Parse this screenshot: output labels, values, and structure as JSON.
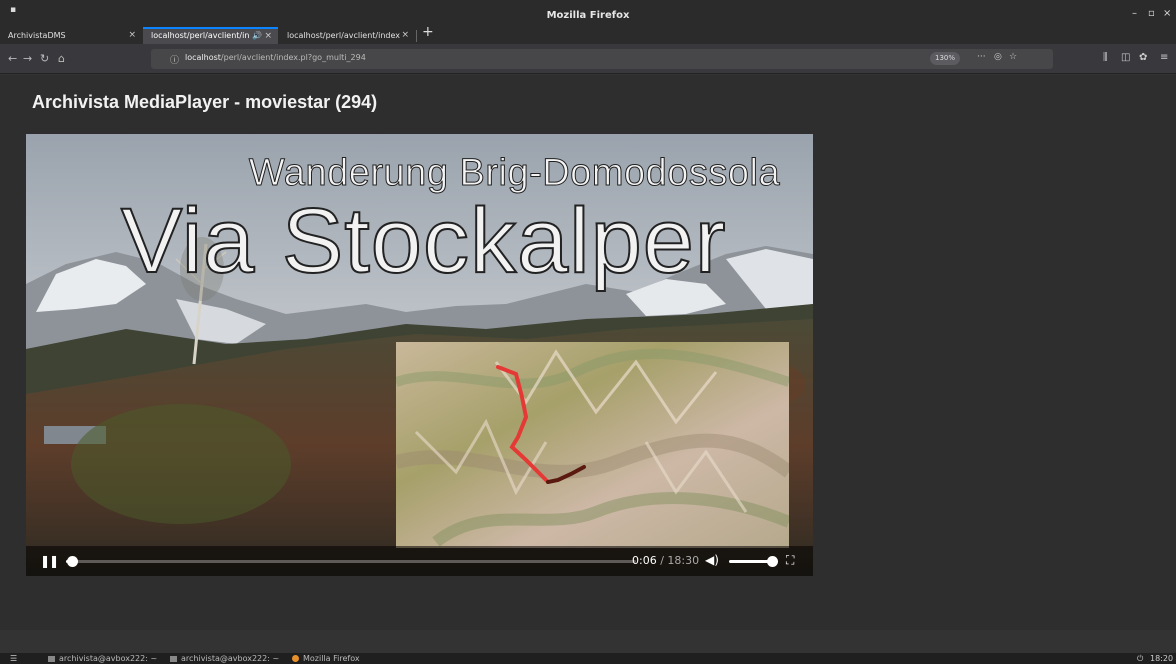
{
  "window": {
    "title": "Mozilla Firefox",
    "menu_glyph": "▪",
    "minimize": "–",
    "maximize": "▫",
    "close": "×"
  },
  "tabs": [
    {
      "label": "ArchivistaDMS",
      "close": "×"
    },
    {
      "label": "localhost/perl/avclient/in",
      "audio": "🔊",
      "close": "×"
    },
    {
      "label": "localhost/perl/avclient/index",
      "close": "×"
    }
  ],
  "new_tab": "+",
  "nav": {
    "back": "←",
    "forward": "→",
    "reload": "↻",
    "home": "⌂",
    "info": "ⓘ",
    "url_host": "localhost",
    "url_path": "/perl/avclient/index.pl?go_multi_294",
    "zoom": "130%",
    "page_actions": "···",
    "pocket": "◎",
    "bookmark": "☆",
    "library": "⫼",
    "sidebar": "◫",
    "extension": "✿",
    "menu": "≡"
  },
  "page": {
    "title": "Archivista MediaPlayer - moviestar (294)"
  },
  "video": {
    "overlay_subtitle": "Wanderung Brig-Domodossola",
    "overlay_title": "Via Stockalper",
    "current_time": "0:06",
    "separator": " / ",
    "duration": "18:30",
    "progress": 0.0054,
    "volume": 1.0,
    "pause": "❚❚",
    "volume_icon": "◀)",
    "fullscreen": "⛶"
  },
  "taskbar": {
    "menu": "☰",
    "items": [
      {
        "label": "archivista@avbox222: ~"
      },
      {
        "label": "archivista@avbox222: ~"
      },
      {
        "label": "Mozilla Firefox"
      }
    ],
    "clock": "18:20",
    "power": "⏻"
  },
  "colors": {
    "accent": "#0a84ff",
    "route": "#e53935",
    "route_end": "#5a1a10"
  }
}
